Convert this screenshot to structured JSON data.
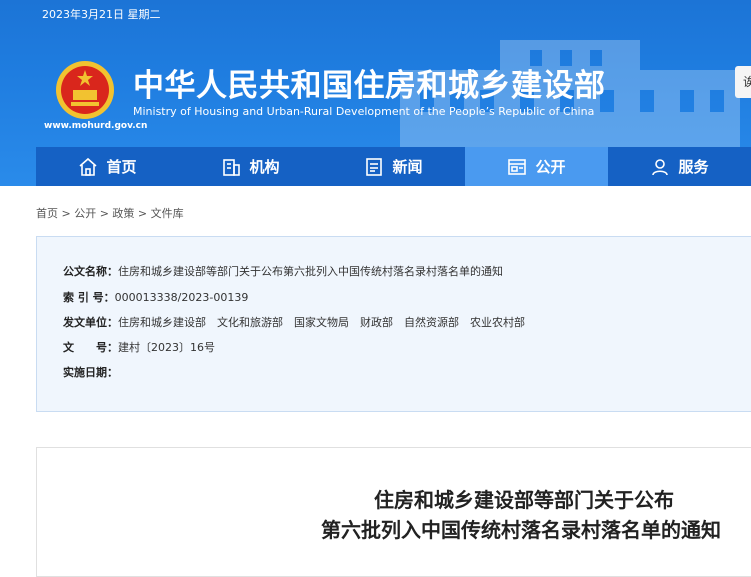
{
  "header": {
    "date": "2023年3月21日 星期二",
    "title_cn": "中华人民共和国住房和城乡建设部",
    "title_en": "Ministry of Housing and Urban-Rural Development of the People’s Republic of China",
    "site_url": "www.mohurd.gov.cn",
    "side_button": "诶"
  },
  "nav": [
    {
      "label": "首页",
      "icon": "home-icon"
    },
    {
      "label": "机构",
      "icon": "building-icon"
    },
    {
      "label": "新闻",
      "icon": "news-icon"
    },
    {
      "label": "公开",
      "icon": "disclosure-icon",
      "active": true
    },
    {
      "label": "服务",
      "icon": "service-icon"
    }
  ],
  "breadcrumb": "首页 > 公开 > 政策 > 文件库",
  "info": {
    "doc_name_label": "公文名称：",
    "doc_name": "住房和城乡建设部等部门关于公布第六批列入中国传统村落名录村落名单的通知",
    "index_label": "索 引 号：",
    "index": "000013338/2023-00139",
    "issuer_label": "发文单位：",
    "issuer": "住房和城乡建设部　文化和旅游部　国家文物局　财政部　自然资源部　农业农村部",
    "docno_label": "文　　号：",
    "docno": "建村〔2023〕16号",
    "date_label": "实施日期："
  },
  "document": {
    "title_line1": "住房和城乡建设部等部门关于公布",
    "title_line2": "第六批列入中国传统村落名录村落名单的通知"
  },
  "colors": {
    "header_blue": "#1f7de0",
    "nav_blue": "#1561c4",
    "nav_active": "#4a9af0",
    "info_bg": "#f0f6fd"
  }
}
